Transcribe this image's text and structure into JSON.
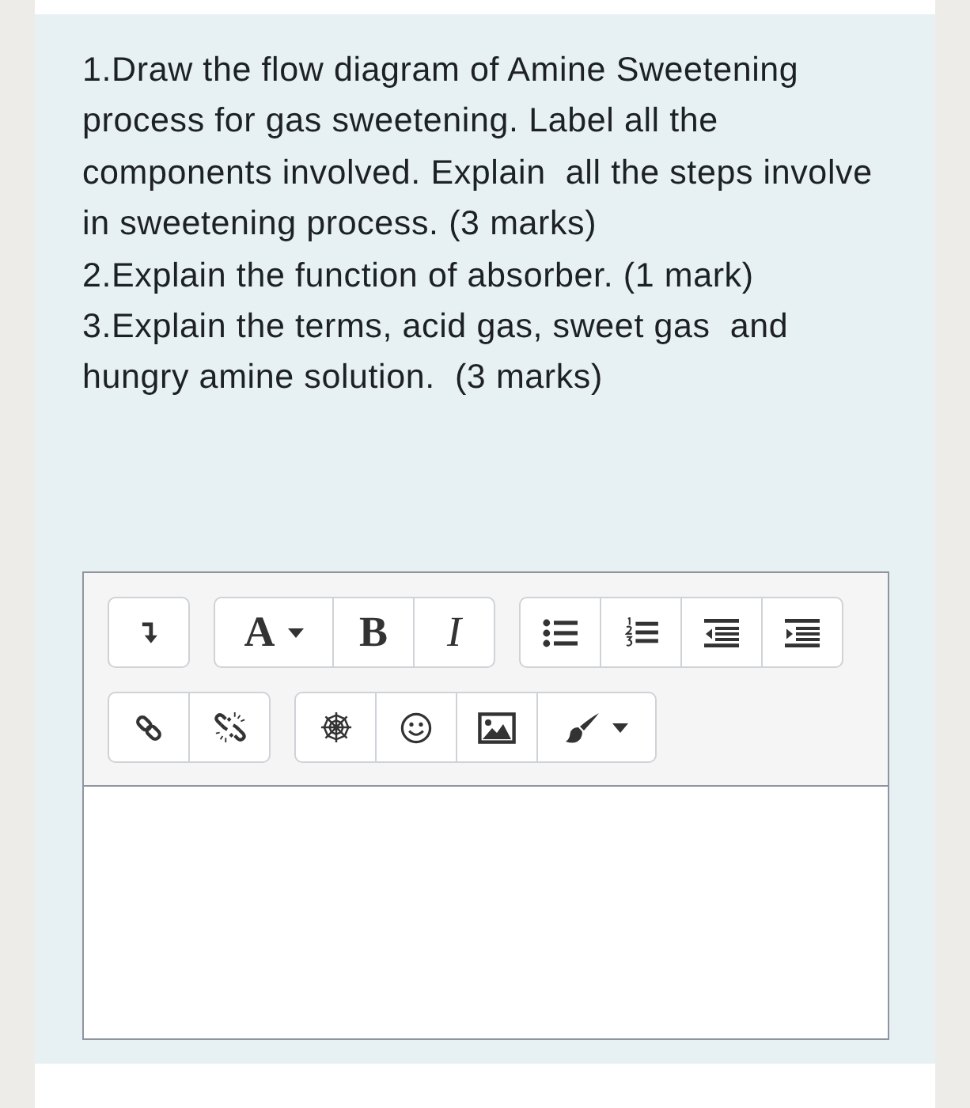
{
  "question": {
    "items": [
      "1.Draw the flow diagram of Amine Sweetening\nprocess for gas sweetening. Label all the\ncomponents involved. Explain  all the steps involve\nin sweetening process. (3 marks)",
      "2.Explain the function of absorber. (1 mark)",
      "3.Explain the terms, acid gas, sweet gas  and\nhungry amine solution.  (3 marks)"
    ]
  },
  "editor": {
    "toolbar": [
      [
        {
          "kind": "collapse",
          "dropdown": false
        }
      ],
      [
        {
          "kind": "style",
          "label": "A",
          "dropdown": true
        },
        {
          "kind": "bold",
          "label": "B",
          "dropdown": false
        },
        {
          "kind": "italic",
          "label": "I",
          "dropdown": false
        }
      ],
      [
        {
          "kind": "bullets",
          "dropdown": false
        },
        {
          "kind": "numbers",
          "dropdown": false
        },
        {
          "kind": "outdent",
          "dropdown": false
        },
        {
          "kind": "indent",
          "dropdown": false
        }
      ],
      [
        {
          "kind": "link",
          "dropdown": false
        },
        {
          "kind": "unlink",
          "dropdown": false
        }
      ],
      [
        {
          "kind": "web",
          "dropdown": false
        },
        {
          "kind": "emoji",
          "dropdown": false
        },
        {
          "kind": "image",
          "dropdown": false
        },
        {
          "kind": "brush",
          "dropdown": true
        }
      ]
    ]
  }
}
